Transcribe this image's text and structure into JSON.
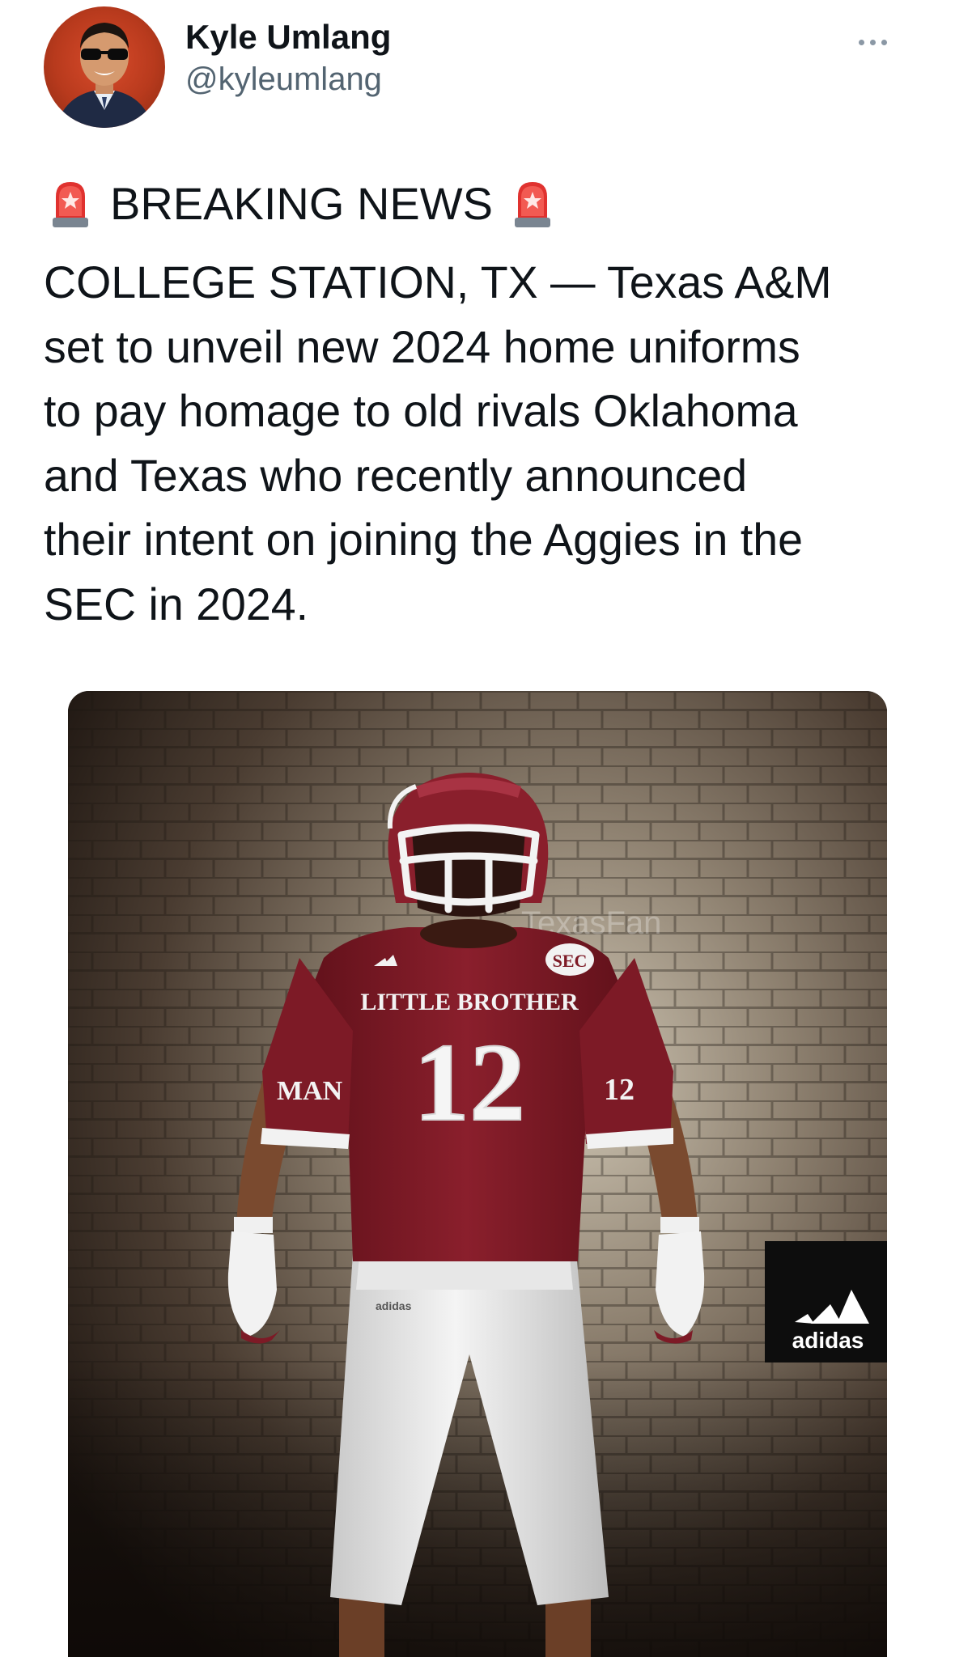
{
  "author": {
    "display_name": "Kyle Umlang",
    "handle": "@kyleumlang"
  },
  "tweet": {
    "headline": "BREAKING NEWS",
    "body_lines": [
      "COLLEGE STATION, TX — Texas A&M",
      "set to unveil new 2024 home uniforms",
      "to pay homage to old rivals Oklahoma",
      "and Texas who recently announced",
      "their intent on joining the Aggies in the",
      "SEC in 2024."
    ]
  },
  "media": {
    "jersey_nameplate": "LITTLE BROTHER",
    "jersey_number": "12",
    "sleeve_number": "12",
    "collar_patch": "SEC",
    "sleeve_lettering": "MAN",
    "watermark": "TexasFan",
    "brand_logo_text": "adidas"
  },
  "colors": {
    "maroon": "#7d1a26",
    "text": "#0f1419",
    "secondary_text": "#536471",
    "avatar_bg": "#c7441f"
  },
  "icons": {
    "avatar": "profile-photo",
    "more": "more-options-icon",
    "siren": "police-car-light-emoji"
  }
}
